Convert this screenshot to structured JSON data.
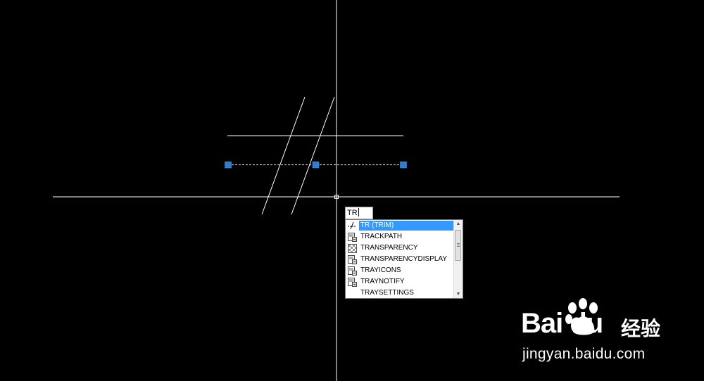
{
  "command_input": {
    "value": "TR"
  },
  "autocomplete": {
    "items": [
      {
        "label": "TR (TRIM)",
        "icon": "trim-icon",
        "selected": true
      },
      {
        "label": "TRACKPATH",
        "icon": "system-variable-icon",
        "selected": false
      },
      {
        "label": "TRANSPARENCY",
        "icon": "transparency-icon",
        "selected": false
      },
      {
        "label": "TRANSPARENCYDISPLAY",
        "icon": "system-variable-icon",
        "selected": false
      },
      {
        "label": "TRAYICONS",
        "icon": "system-variable-icon",
        "selected": false
      },
      {
        "label": "TRAYNOTIFY",
        "icon": "system-variable-icon",
        "selected": false
      },
      {
        "label": "TRAYSETTINGS",
        "icon": "",
        "selected": false
      }
    ]
  },
  "watermark": {
    "brand": "Bai du",
    "product": "经验",
    "url": "jingyan.baidu.com"
  },
  "colors": {
    "background": "#000000",
    "geometry": "#ffffff",
    "grip": "#2b7ed8",
    "selection": "#3399ff"
  }
}
